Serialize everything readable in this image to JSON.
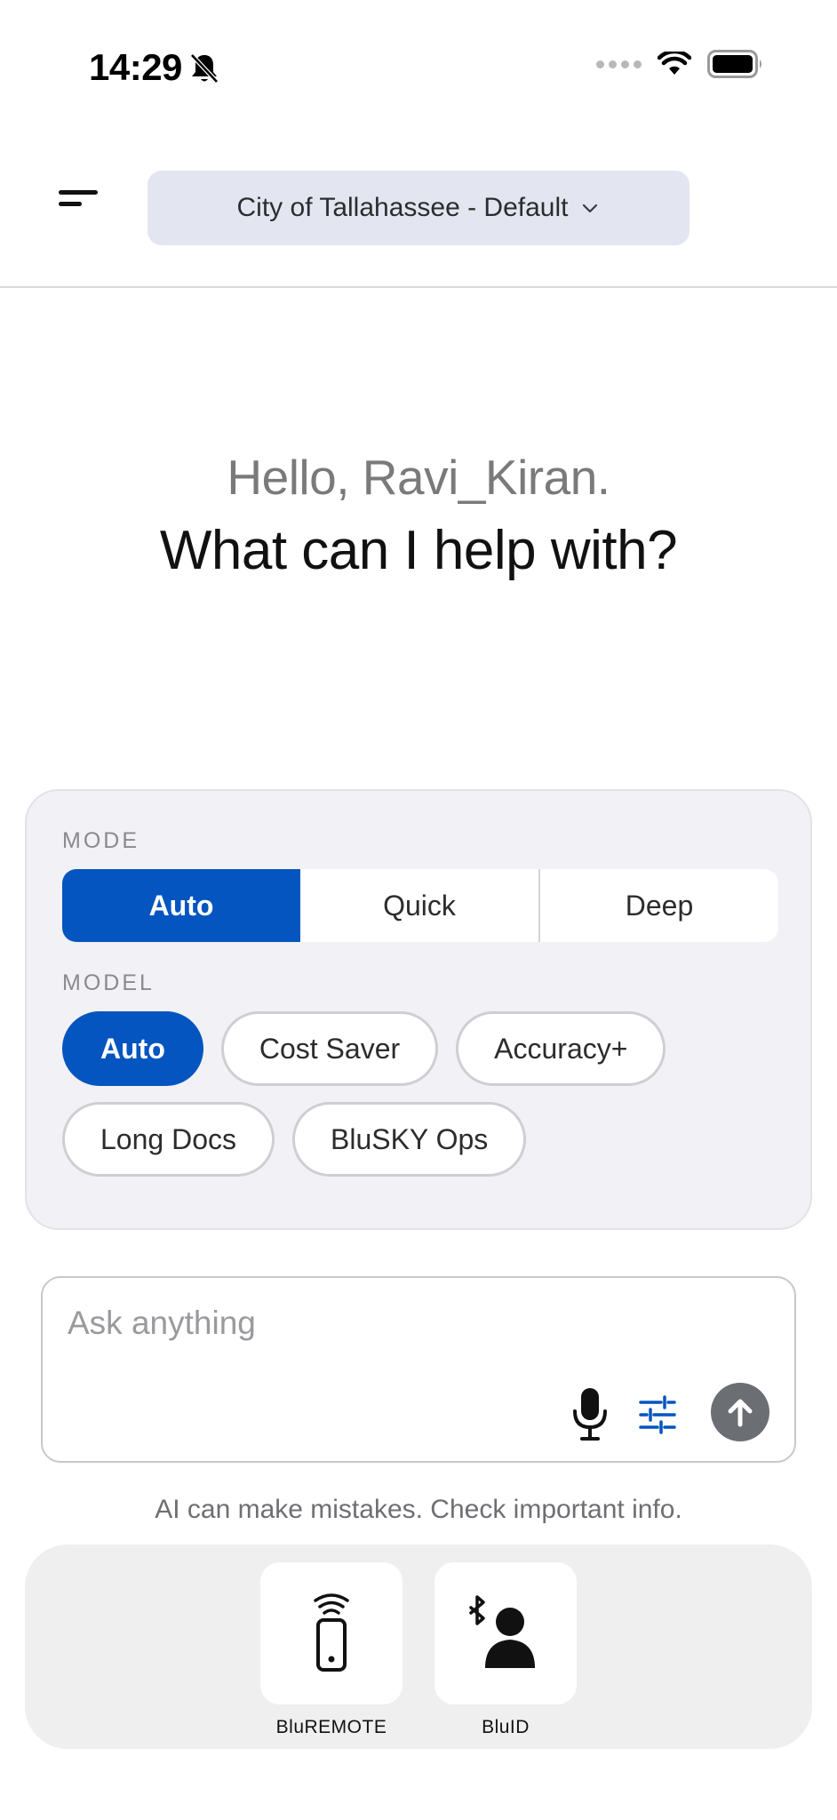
{
  "status_bar": {
    "time": "14:29"
  },
  "header": {
    "org_selector": "City of Tallahassee - Default"
  },
  "greeting": {
    "hello": "Hello, Ravi_Kiran.",
    "prompt": "What can I help with?"
  },
  "options": {
    "mode_label": "MODE",
    "modes": [
      {
        "label": "Auto",
        "selected": true
      },
      {
        "label": "Quick",
        "selected": false
      },
      {
        "label": "Deep",
        "selected": false
      }
    ],
    "model_label": "MODEL",
    "models": [
      {
        "label": "Auto",
        "selected": true
      },
      {
        "label": "Cost Saver",
        "selected": false
      },
      {
        "label": "Accuracy+",
        "selected": false
      },
      {
        "label": "Long Docs",
        "selected": false
      },
      {
        "label": "BluSKY Ops",
        "selected": false
      }
    ]
  },
  "input": {
    "placeholder": "Ask anything",
    "value": ""
  },
  "disclaimer": "AI can make mistakes. Check important info.",
  "apps": [
    {
      "name": "BluREMOTE",
      "icon": "remote-phone-icon"
    },
    {
      "name": "BluID",
      "icon": "bluetooth-person-icon"
    }
  ],
  "colors": {
    "accent": "#0455bf",
    "send_button": "#6b6e72",
    "card_bg": "#f1f1f6",
    "selector_bg": "#e3e6f1"
  }
}
